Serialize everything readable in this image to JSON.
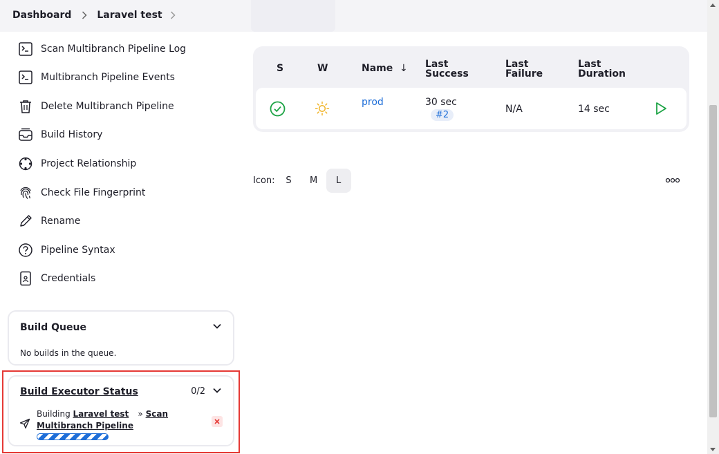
{
  "breadcrumb": {
    "items": [
      "Dashboard",
      "Laravel test"
    ]
  },
  "sidebar": {
    "items": [
      {
        "label": "Scan Multibranch Pipeline Log",
        "icon": "terminal-icon"
      },
      {
        "label": "Multibranch Pipeline Events",
        "icon": "terminal-icon"
      },
      {
        "label": "Delete Multibranch Pipeline",
        "icon": "trash-icon"
      },
      {
        "label": "Build History",
        "icon": "inbox-icon"
      },
      {
        "label": "Project Relationship",
        "icon": "relationship-icon"
      },
      {
        "label": "Check File Fingerprint",
        "icon": "fingerprint-icon"
      },
      {
        "label": "Rename",
        "icon": "pencil-icon"
      },
      {
        "label": "Pipeline Syntax",
        "icon": "help-circle-icon"
      },
      {
        "label": "Credentials",
        "icon": "id-card-icon"
      }
    ]
  },
  "build_queue": {
    "title": "Build Queue",
    "empty_text": "No builds in the queue."
  },
  "executor": {
    "title": "Build Executor Status",
    "count": "0/2",
    "prefix": "Building",
    "job": "Laravel test",
    "separator": "»",
    "task_part1": "Scan",
    "task_part2": "Multibranch Pipeline"
  },
  "table": {
    "headers": {
      "s": "S",
      "w": "W",
      "name": "Name",
      "sort": "↓",
      "last_success_1": "Last",
      "last_success_2": "Success",
      "last_failure_1": "Last",
      "last_failure_2": "Failure",
      "last_duration_1": "Last",
      "last_duration_2": "Duration"
    },
    "rows": [
      {
        "status_icon": "success-check-icon",
        "weather_icon": "sunny-icon",
        "name": "prod",
        "last_success": "30 sec",
        "build": "#2",
        "last_failure": "N/A",
        "last_duration": "14 sec",
        "action_icon": "play-icon"
      }
    ]
  },
  "icon_size": {
    "label": "Icon:",
    "options": [
      "S",
      "M",
      "L"
    ],
    "selected": "L"
  },
  "colors": {
    "accent": "#1e6ed8",
    "success": "#1ea446",
    "weather": "#f0b429",
    "highlight": "#e53935"
  }
}
